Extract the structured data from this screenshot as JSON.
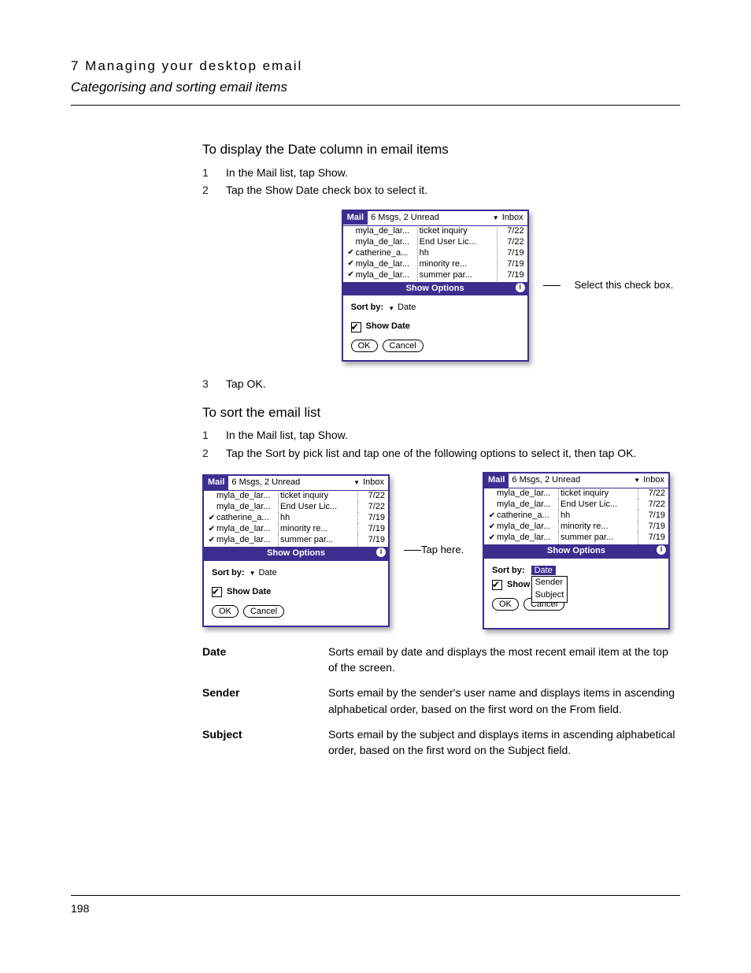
{
  "header": {
    "chapter": "7 Managing your desktop email",
    "section": "Categorising and sorting email items"
  },
  "section1": {
    "heading": "To display the Date column in email items",
    "step1_num": "1",
    "step1_text": "In the Mail list, tap Show.",
    "step2_num": "2",
    "step2_text": "Tap the Show Date check box to select it.",
    "step3_num": "3",
    "step3_text": "Tap OK.",
    "annotation": "Select this check box."
  },
  "section2": {
    "heading": "To sort the email list",
    "step1_num": "1",
    "step1_text": "In the Mail list, tap Show.",
    "step2_num": "2",
    "step2_text": "Tap the Sort by pick list and tap one of the following options to select it, then tap OK.",
    "annotation": "Tap here."
  },
  "palm": {
    "app": "Mail",
    "msgs": "6 Msgs, 2 Unread",
    "folder": "Inbox",
    "panel_title": "Show Options",
    "sort_label": "Sort by:",
    "sort_value": "Date",
    "showdate_label": "Show Date",
    "show_partial": "Show I",
    "ok": "OK",
    "cancel": "Cancel",
    "rows": [
      {
        "chk": "",
        "from": "myla_de_lar...",
        "subj": "ticket inquiry",
        "date": "7/22"
      },
      {
        "chk": "",
        "from": "myla_de_lar...",
        "subj": "End User Lic...",
        "date": "7/22"
      },
      {
        "chk": "✔",
        "from": "catherine_a...",
        "subj": "hh",
        "date": "7/19"
      },
      {
        "chk": "✔",
        "from": "myla_de_lar...",
        "subj": "minority re...",
        "date": "7/19"
      },
      {
        "chk": "✔",
        "from": "myla_de_lar...",
        "subj": "summer par...",
        "date": "7/19"
      }
    ],
    "options": {
      "o0": "Date",
      "o1": "Sender",
      "o2": "Subject"
    }
  },
  "defs": {
    "d0_term": "Date",
    "d0_def": "Sorts email by date and displays the most recent email item at the top of the screen.",
    "d1_term": "Sender",
    "d1_def": "Sorts email by the sender's user name and displays items in ascending alphabetical order, based on the first word on the From field.",
    "d2_term": "Subject",
    "d2_def": "Sorts email by the subject and displays items in ascending alphabetical order, based on the first word on the Subject field."
  },
  "page_number": "198"
}
